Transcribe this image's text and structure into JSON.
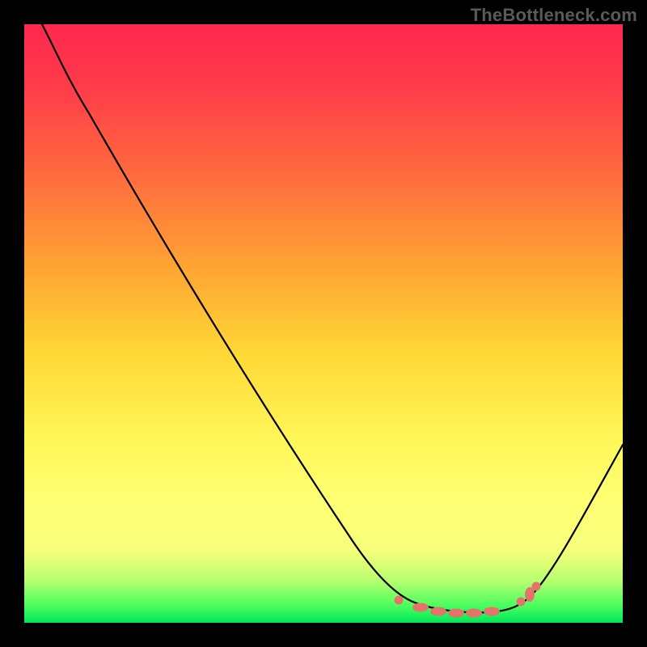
{
  "watermark": "TheBottleneck.com",
  "chart_data": {
    "type": "line",
    "title": "",
    "xlabel": "",
    "ylabel": "",
    "xlim": [
      0,
      100
    ],
    "ylim": [
      0,
      100
    ],
    "grid": false,
    "legend": false,
    "series": [
      {
        "name": "bottleneck-curve",
        "x": [
          3,
          8,
          15,
          25,
          35,
          45,
          55,
          62,
          66,
          70,
          74,
          78,
          82,
          85,
          88,
          92,
          96,
          100
        ],
        "y": [
          100,
          94,
          85,
          71,
          57,
          43,
          29,
          18,
          11,
          6,
          3,
          1.5,
          1,
          1.5,
          3,
          9,
          18,
          30
        ]
      }
    ],
    "markers": {
      "name": "low-bottleneck-points",
      "shape": "round",
      "color": "#e5736c",
      "x": [
        63,
        66.5,
        69,
        71,
        73,
        75,
        77,
        79,
        83.5,
        85
      ],
      "y": [
        2.8,
        2.2,
        1.8,
        1.6,
        1.5,
        1.5,
        1.6,
        1.7,
        2.4,
        3.2
      ]
    }
  }
}
